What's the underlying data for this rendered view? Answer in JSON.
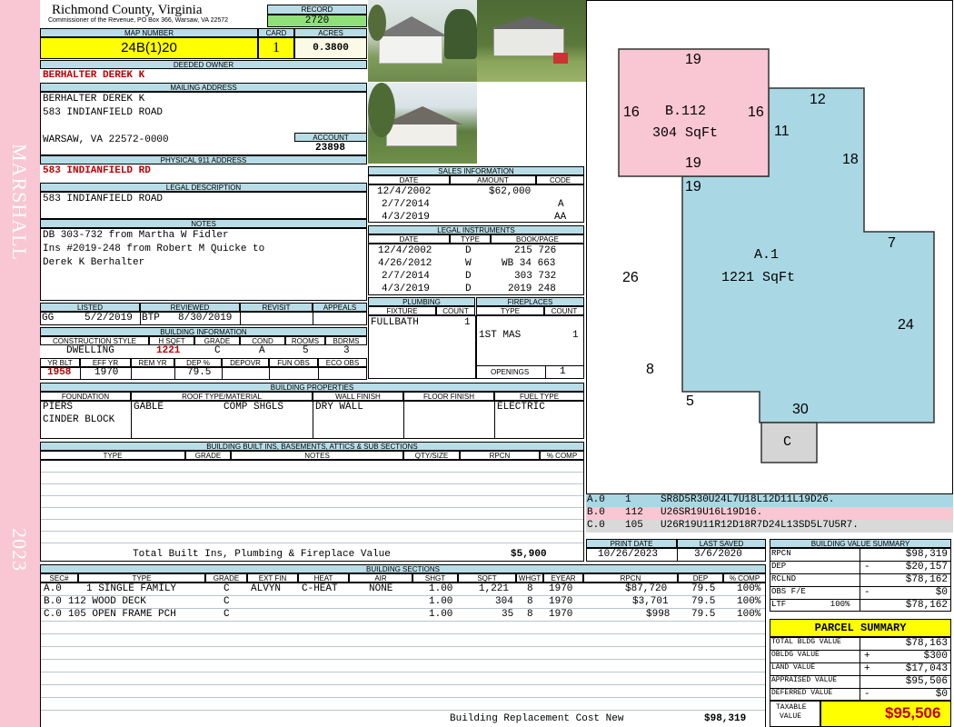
{
  "county": {
    "name": "Richmond County, Virginia",
    "address": "Commissioner of the Revenue, PO Box 366, Warsaw, VA 22572"
  },
  "sidebar": {
    "name": "MARSHALL",
    "year": "2023"
  },
  "record": {
    "label": "RECORD",
    "value": "2720"
  },
  "map": {
    "label": "MAP NUMBER",
    "value": "24B(1)20",
    "card_label": "CARD",
    "card": "1",
    "acres_label": "ACRES",
    "acres": "0.3800"
  },
  "owner": {
    "label": "DEEDED OWNER",
    "value": "BERHALTER DEREK K"
  },
  "mailing": {
    "label": "MAILING ADDRESS",
    "line1": "BERHALTER DEREK K",
    "line2": "583 INDIANFIELD ROAD",
    "line3": "WARSAW, VA 22572-0000",
    "account_label": "ACCOUNT",
    "account": "23898"
  },
  "physical": {
    "label": "PHYSICAL 911 ADDRESS",
    "value": "583 INDIANFIELD RD"
  },
  "legal": {
    "label": "LEGAL DESCRIPTION",
    "value": "583 INDIANFIELD ROAD"
  },
  "notes": {
    "label": "NOTES",
    "lines": [
      "DB 303-732 from Martha W Fidler",
      "Ins #2019-248 from Robert M Quicke to",
      "Derek K Berhalter"
    ]
  },
  "listed": {
    "labels": [
      "LISTED",
      "REVIEWED",
      "REVISIT",
      "APPEALS"
    ],
    "listed_by": "GG",
    "listed_date": "5/2/2019",
    "reviewed_by": "BTP",
    "reviewed_date": "8/30/2019"
  },
  "bldg_info": {
    "label": "BUILDING INFORMATION",
    "heads": [
      "CONSTRUCTION STYLE",
      "H SQFT",
      "GRADE",
      "COND",
      "ROOMS",
      "BDRMS"
    ],
    "values": [
      "DWELLING",
      "1221",
      "C",
      "A",
      "5",
      "3"
    ],
    "heads2": [
      "YR BLT",
      "EFF YR",
      "REM YR",
      "DEP %",
      "DEPOVR",
      "FUN OBS",
      "ECO OBS"
    ],
    "values2": [
      "1958",
      "1970",
      "",
      "79.5",
      "",
      "",
      ""
    ]
  },
  "sales": {
    "label": "SALES INFORMATION",
    "heads": [
      "DATE",
      "AMOUNT",
      "CODE"
    ],
    "rows": [
      [
        "12/4/2002",
        "$62,000",
        ""
      ],
      [
        "2/7/2014",
        "",
        "A"
      ],
      [
        "4/3/2019",
        "",
        "AA"
      ]
    ]
  },
  "instruments": {
    "label": "LEGAL INSTRUMENTS",
    "heads": [
      "DATE",
      "TYPE",
      "BOOK/PAGE"
    ],
    "rows": [
      [
        "12/4/2002",
        "D",
        "215 726"
      ],
      [
        "4/26/2012",
        "W",
        "WB 34 663"
      ],
      [
        "2/7/2014",
        "D",
        "303 732"
      ],
      [
        "4/3/2019",
        "D",
        "2019 248"
      ]
    ]
  },
  "plumbing": {
    "label": "PLUMBING",
    "heads": [
      "FIXTURE",
      "COUNT"
    ],
    "fixture": "FULLBATH",
    "count": "1"
  },
  "fireplaces": {
    "label": "FIREPLACES",
    "heads": [
      "TYPE",
      "COUNT"
    ],
    "type": "1ST MAS",
    "count": "1",
    "openings_label": "OPENINGS",
    "openings": "1"
  },
  "props": {
    "label": "BUILDING PROPERTIES",
    "heads": [
      "FOUNDATION",
      "ROOF TYPE/MATERIAL",
      "WALL FINISH",
      "FLOOR FINISH",
      "FUEL TYPE"
    ],
    "foundation1": "PIERS",
    "foundation2": "CINDER BLOCK",
    "roof_type": "GABLE",
    "roof_mat": "COMP SHGLS",
    "wall": "DRY WALL",
    "floor": "",
    "fuel": "ELECTRIC"
  },
  "builtins": {
    "label": "BUILDING BUILT INS, BASEMENTS, ATTICS & SUB SECTIONS",
    "heads": [
      "TYPE",
      "GRADE",
      "NOTES",
      "QTY/SIZE",
      "RPCN",
      "% COMP"
    ],
    "total_label": "Total Built Ins, Plumbing & Fireplace Value",
    "total": "$5,900"
  },
  "sections": {
    "label": "BUILDING SECTIONS",
    "heads": [
      "SEC#",
      "TYPE",
      "GRADE",
      "EXT FIN",
      "HEAT",
      "AIR",
      "SHGT",
      "SQFT",
      "WHGT",
      "EYEAR",
      "RPCN",
      "DEP",
      "% COMP"
    ],
    "rows": [
      [
        "A.0",
        "1 SINGLE FAMILY",
        "C",
        "ALVYN",
        "C-HEAT",
        "NONE",
        "1.00",
        "1,221",
        "8",
        "1970",
        "$87,720",
        "79.5",
        "100%"
      ],
      [
        "B.0",
        "112 WOOD DECK",
        "C",
        "",
        "",
        "",
        "1.00",
        "304",
        "8",
        "1970",
        "$3,701",
        "79.5",
        "100%"
      ],
      [
        "C.0",
        "105 OPEN FRAME PCH",
        "C",
        "",
        "",
        "",
        "1.00",
        "35",
        "8",
        "1970",
        "$998",
        "79.5",
        "100%"
      ]
    ],
    "brc_label": "Building Replacement Cost New",
    "brc": "$98,319"
  },
  "sketch": {
    "pink_label": "B.112",
    "pink_area": "304 SqFt",
    "blue_label": "A.1",
    "blue_area": "1221 SqFt",
    "small_label": "C",
    "dims": {
      "p_top": "19",
      "p_left": "16",
      "p_right": "16",
      "p_bottom": "19",
      "b_11": "11",
      "b_12": "12",
      "b_18": "18",
      "b_19": "19",
      "b_7": "7",
      "b_26": "26",
      "b_24": "24",
      "b_8": "8",
      "b_5": "5",
      "b_30": "30"
    },
    "codes": [
      [
        "A.0",
        "1",
        "SR8D5R30U24L7U18L12D11L19D26."
      ],
      [
        "B.0",
        "112",
        "U26SR19U16L19D16."
      ],
      [
        "C.0",
        "105",
        "U26R19U11R12D18R7D24L13SD5L7U5R7."
      ]
    ]
  },
  "dates": {
    "print_label": "PRINT DATE",
    "print": "10/26/2023",
    "saved_label": "LAST SAVED",
    "saved": "3/6/2020"
  },
  "bvs": {
    "label": "BUILDING VALUE SUMMARY",
    "rows": [
      [
        "RPCN",
        "",
        "$98,319"
      ],
      [
        "DEP",
        "-",
        "$20,157"
      ],
      [
        "RCLND",
        "",
        "$78,162"
      ],
      [
        "OBS F/E",
        "-",
        "$0"
      ],
      [
        "LTF         100%",
        "",
        "$78,162"
      ]
    ]
  },
  "parcel": {
    "label": "PARCEL SUMMARY",
    "rows": [
      [
        "TOTAL BLDG VALUE",
        "",
        "$78,163"
      ],
      [
        "OBLDG VALUE",
        "+",
        "$300"
      ],
      [
        "LAND VALUE",
        "+",
        "$17,043"
      ],
      [
        "APPRAISED VALUE",
        "",
        "$95,506"
      ],
      [
        "DEFERRED VALUE",
        "-",
        "$0"
      ]
    ],
    "taxable_label1": "TAXABLE",
    "taxable_label2": "VALUE",
    "taxable": "$95,506"
  },
  "colors": {
    "header": "#b9dde6",
    "pink": "#f9c6d3",
    "blue": "#a9d7e3",
    "yellow": "#ffff00",
    "red": "#c00000",
    "green": "#8fe07a"
  }
}
